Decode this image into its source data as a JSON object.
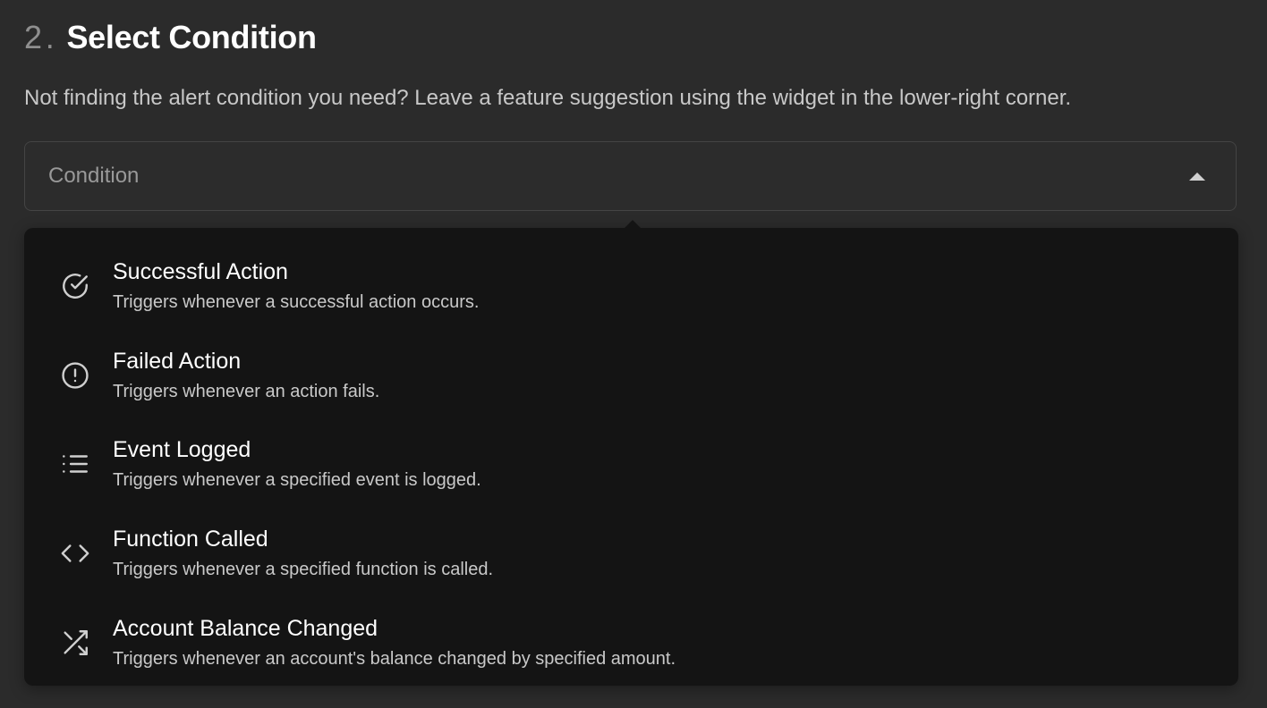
{
  "section": {
    "step_number": "2",
    "step_separator": ".",
    "title": "Select Condition",
    "subtitle": "Not finding the alert condition you need? Leave a feature suggestion using the widget in the lower-right corner."
  },
  "select": {
    "placeholder": "Condition",
    "expanded": true,
    "caret_icon": "caret-up-icon"
  },
  "options": [
    {
      "title": "Successful Action",
      "description": "Triggers whenever a successful action occurs.",
      "icon": "check-circle-icon"
    },
    {
      "title": "Failed Action",
      "description": "Triggers whenever an action fails.",
      "icon": "alert-circle-icon"
    },
    {
      "title": "Event Logged",
      "description": "Triggers whenever a specified event is logged.",
      "icon": "list-icon"
    },
    {
      "title": "Function Called",
      "description": "Triggers whenever a specified function is called.",
      "icon": "code-icon"
    },
    {
      "title": "Account Balance Changed",
      "description": "Triggers whenever an account's balance changed by specified amount.",
      "icon": "shuffle-icon"
    }
  ],
  "colors": {
    "page_background": "#2b2b2b",
    "dropdown_background": "#141414",
    "muted_text": "#999999",
    "primary_text": "#ffffff"
  }
}
